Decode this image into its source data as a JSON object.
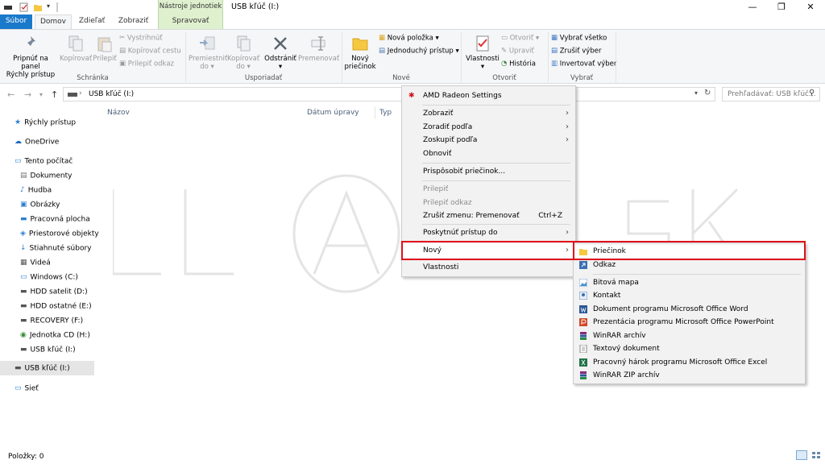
{
  "window": {
    "title": "USB kľúč (I:)",
    "tool_tab_group": "Nástroje jednotiek",
    "controls": {
      "minimize": "—",
      "maximize": "❐",
      "close": "✕"
    }
  },
  "tabs": {
    "file": "Súbor",
    "home": "Domov",
    "share": "Zdieľať",
    "view": "Zobraziť",
    "manage": "Spravovať"
  },
  "ribbon": {
    "clipboard": {
      "label": "Schránka",
      "pin_line1": "Pripnúť na panel",
      "pin_line2": "Rýchly prístup",
      "copy": "Kopírovať",
      "paste": "Prilepiť",
      "cut": "Vystrihnúť",
      "copy_path": "Kopírovať cestu",
      "paste_shortcut": "Prilepiť odkaz"
    },
    "organize": {
      "label": "Usporiadať",
      "move_to_1": "Premiestniť",
      "move_to_2": "do ▾",
      "copy_to_1": "Kopírovať",
      "copy_to_2": "do ▾",
      "delete_1": "Odstrániť",
      "delete_2": "▾",
      "rename": "Premenovať"
    },
    "new": {
      "label": "Nové",
      "new_folder_1": "Nový",
      "new_folder_2": "priečinok",
      "new_item": "Nová položka ▾",
      "easy_access": "Jednoduchý prístup ▾"
    },
    "open": {
      "label": "Otvoriť",
      "properties_1": "Vlastnosti",
      "properties_2": "▾",
      "open": "Otvoriť ▾",
      "edit": "Upraviť",
      "history": "História"
    },
    "select": {
      "label": "Vybrať",
      "select_all": "Vybrať všetko",
      "select_none": "Zrušiť výber",
      "invert": "Invertovať výber"
    }
  },
  "address": {
    "path": "USB kľúč (I:)",
    "search_placeholder": "Prehľadávať: USB kľúč..."
  },
  "sidebar": {
    "items": [
      {
        "label": "Rýchly prístup",
        "icon": "star-icon"
      },
      {
        "label": "OneDrive",
        "icon": "cloud-icon"
      },
      {
        "label": "Tento počítač",
        "icon": "computer-icon"
      },
      {
        "label": "Dokumenty",
        "icon": "documents-icon"
      },
      {
        "label": "Hudba",
        "icon": "music-icon"
      },
      {
        "label": "Obrázky",
        "icon": "pictures-icon"
      },
      {
        "label": "Pracovná plocha",
        "icon": "desktop-icon"
      },
      {
        "label": "Priestorové objekty",
        "icon": "3d-objects-icon"
      },
      {
        "label": "Stiahnuté súbory",
        "icon": "downloads-icon"
      },
      {
        "label": "Videá",
        "icon": "videos-icon"
      },
      {
        "label": "Windows (C:)",
        "icon": "drive-icon"
      },
      {
        "label": "HDD satelit (D:)",
        "icon": "drive-icon"
      },
      {
        "label": "HDD ostatné (E:)",
        "icon": "drive-icon"
      },
      {
        "label": "RECOVERY (F:)",
        "icon": "drive-icon"
      },
      {
        "label": "Jednotka CD (H:)",
        "icon": "cd-icon"
      },
      {
        "label": "USB kľúč (I:)",
        "icon": "usb-icon"
      },
      {
        "label": "USB kľúč (I:)",
        "icon": "usb-icon"
      },
      {
        "label": "Sieť",
        "icon": "network-icon"
      }
    ]
  },
  "columns": {
    "name": "Názov",
    "date": "Dátum úpravy",
    "type": "Typ"
  },
  "status": {
    "items": "Položky: 0"
  },
  "context_menu": {
    "amd": "AMD Radeon Settings",
    "view": "Zobraziť",
    "sort": "Zoradiť podľa",
    "group": "Zoskupiť podľa",
    "refresh": "Obnoviť",
    "customize": "Prispôsobiť priečinok...",
    "paste": "Prilepiť",
    "paste_shortcut": "Prilepiť odkaz",
    "undo": "Zrušiť zmenu: Premenovať",
    "undo_shortcut": "Ctrl+Z",
    "give_access": "Poskytnúť prístup do",
    "new": "Nový",
    "properties": "Vlastnosti"
  },
  "submenu": {
    "items": [
      {
        "label": "Priečinok",
        "icon": "folder-icon"
      },
      {
        "label": "Odkaz",
        "icon": "shortcut-icon"
      },
      {
        "label": "Bitová mapa",
        "icon": "bitmap-icon"
      },
      {
        "label": "Kontakt",
        "icon": "contact-icon"
      },
      {
        "label": "Dokument programu Microsoft Office Word",
        "icon": "word-icon"
      },
      {
        "label": "Prezentácia programu Microsoft Office PowerPoint",
        "icon": "powerpoint-icon"
      },
      {
        "label": "WinRAR archív",
        "icon": "winrar-icon"
      },
      {
        "label": "Textový dokument",
        "icon": "text-document-icon"
      },
      {
        "label": "Pracovný hárok programu Microsoft Office Excel",
        "icon": "excel-icon"
      },
      {
        "label": "WinRAR ZIP archív",
        "icon": "winrar-zip-icon"
      }
    ]
  },
  "colors": {
    "accent": "#1979ca",
    "tool_tab": "#dff0cf",
    "highlight": "#e0101a",
    "menu_bg": "#f2f2f2"
  }
}
